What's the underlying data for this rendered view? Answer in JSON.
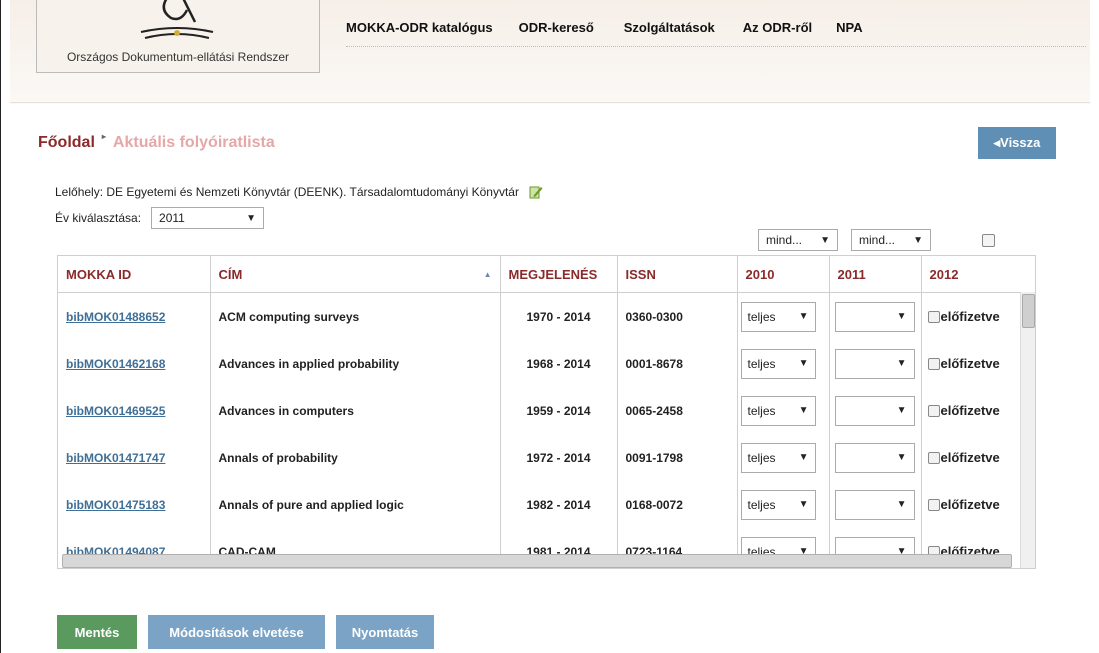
{
  "header": {
    "logo_text": "Országos Dokumentum-ellátási Rendszer",
    "nav": [
      "MOKKA-ODR katalógus",
      "ODR-kereső",
      "Szolgáltatások",
      "Az ODR-ről",
      "NPA"
    ]
  },
  "breadcrumb": {
    "home": "Főoldal",
    "separator": "▸",
    "current": "Aktuális folyóiratlista"
  },
  "back_button": "◂Vissza",
  "location_text": "Lelőhely: DE Egyetemi és Nemzeti Könyvtár (DEENK). Társadalomtudományi Könyvtár",
  "year_select": {
    "label": "Év kiválasztása:",
    "value": "2011"
  },
  "bulk": {
    "col2010": "mind...",
    "col2011": "mind..."
  },
  "table": {
    "headers": [
      "MOKKA ID",
      "CÍM",
      "MEGJELENÉS",
      "ISSN",
      "2010",
      "2011",
      "2012"
    ],
    "rows": [
      {
        "id": "bibMOK01488652",
        "title": "ACM computing surveys",
        "range": "1970 - 2014",
        "issn": "0360-0300",
        "y2010": "teljes",
        "y2011": "",
        "y2012": "előfizetve"
      },
      {
        "id": "bibMOK01462168",
        "title": "Advances in applied probability",
        "range": "1968 - 2014",
        "issn": "0001-8678",
        "y2010": "teljes",
        "y2011": "",
        "y2012": "előfizetve"
      },
      {
        "id": "bibMOK01469525",
        "title": "Advances in computers",
        "range": "1959 - 2014",
        "issn": "0065-2458",
        "y2010": "teljes",
        "y2011": "",
        "y2012": "előfizetve"
      },
      {
        "id": "bibMOK01471747",
        "title": "Annals of probability",
        "range": "1972 - 2014",
        "issn": "0091-1798",
        "y2010": "teljes",
        "y2011": "",
        "y2012": "előfizetve"
      },
      {
        "id": "bibMOK01475183",
        "title": "Annals of pure and applied logic",
        "range": "1982 - 2014",
        "issn": "0168-0072",
        "y2010": "teljes",
        "y2011": "",
        "y2012": "előfizetve"
      },
      {
        "id": "bibMOK01494087",
        "title": "CAD-CAM",
        "range": "1981 - 2014",
        "issn": "0723-1164",
        "y2010": "teljes",
        "y2011": "",
        "y2012": "előfizetve"
      }
    ]
  },
  "buttons": {
    "save": "Mentés",
    "discard": "Módosítások elvetése",
    "print": "Nyomtatás"
  },
  "colors": {
    "brand_red": "#8b2a2a",
    "link_blue": "#3f6f96",
    "save_green": "#5a9a5f",
    "secondary_blue": "#7aa3c6",
    "back_blue": "#5f8fb5"
  }
}
